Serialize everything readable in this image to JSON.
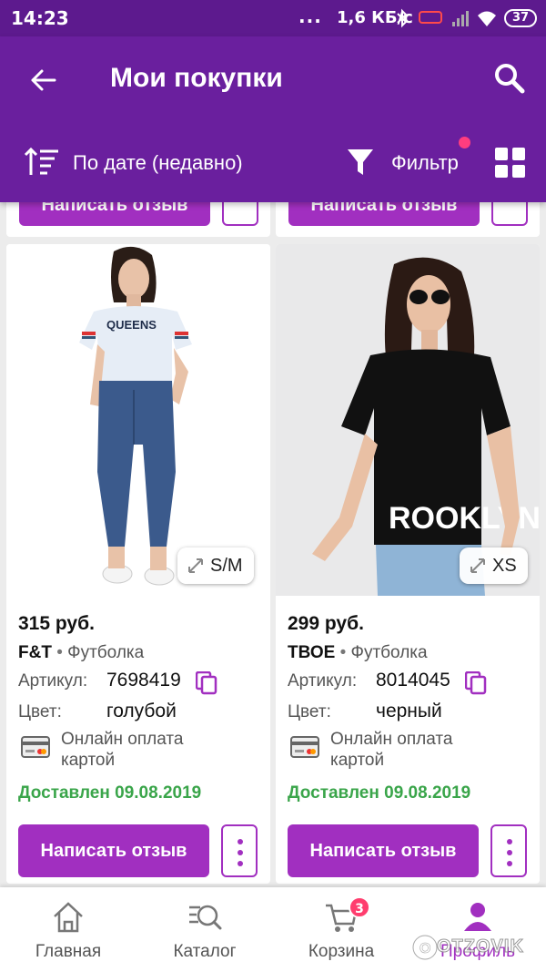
{
  "status_bar": {
    "time": "14:23",
    "dots": "...",
    "speed": "1,6 КБ/с",
    "battery": "37"
  },
  "header": {
    "title": "Мои покупки",
    "sort_label": "По дате (недавно)",
    "filter_label": "Фильтр",
    "accent_color": "#6a1f9e"
  },
  "partial_row": {
    "review_label": "Написать отзыв"
  },
  "labels": {
    "article": "Артикул:",
    "color": "Цвет:",
    "separator": "•",
    "payment": "Онлайн оплата картой",
    "review": "Написать отзыв"
  },
  "products": [
    {
      "price": "315 руб.",
      "brand": "F&T",
      "type": "Футболка",
      "article": "7698419",
      "color": "голубой",
      "status": "Доставлен 09.08.2019",
      "size": "S/M",
      "print_text": "QUEENS"
    },
    {
      "price": "299 руб.",
      "brand": "ТВОЕ",
      "type": "Футболка",
      "article": "8014045",
      "color": "черный",
      "status": "Доставлен 09.08.2019",
      "size": "XS",
      "print_text": "ROOKLYN"
    }
  ],
  "bottom_nav": {
    "items": [
      {
        "label": "Главная",
        "icon": "home-icon"
      },
      {
        "label": "Каталог",
        "icon": "catalog-search-icon"
      },
      {
        "label": "Корзина",
        "icon": "cart-icon",
        "badge": "3"
      },
      {
        "label": "Профиль",
        "icon": "profile-icon",
        "active": true
      }
    ]
  },
  "watermark": "OTZOVIK"
}
